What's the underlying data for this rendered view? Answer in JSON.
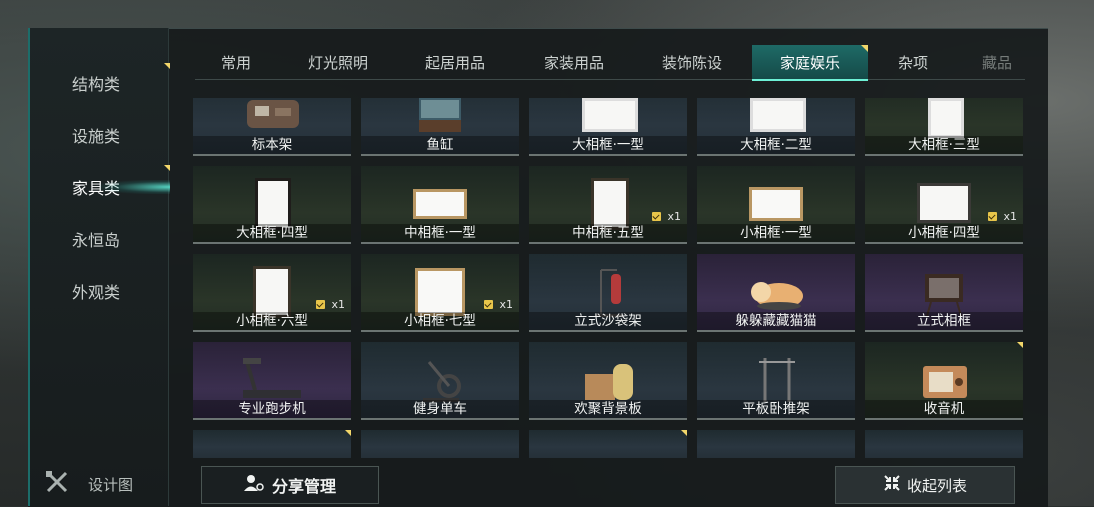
{
  "left_nav": {
    "items": [
      {
        "label": "结构类"
      },
      {
        "label": "设施类"
      },
      {
        "label": "家具类"
      },
      {
        "label": "永恒岛"
      },
      {
        "label": "外观类"
      }
    ],
    "design_label": "设计图"
  },
  "tabs": [
    {
      "label": "常用"
    },
    {
      "label": "灯光照明"
    },
    {
      "label": "起居用品"
    },
    {
      "label": "家装用品"
    },
    {
      "label": "装饰陈设"
    },
    {
      "label": "家庭娱乐"
    },
    {
      "label": "杂项"
    },
    {
      "label": "藏品"
    }
  ],
  "grid": {
    "items": [
      {
        "label": "标本架",
        "icon": "specimen-shelf-icon"
      },
      {
        "label": "鱼缸",
        "icon": "fish-tank-icon"
      },
      {
        "label": "大相框·一型",
        "icon": "photo-frame-icon"
      },
      {
        "label": "大相框·二型",
        "icon": "photo-frame-icon"
      },
      {
        "label": "大相框·三型",
        "icon": "photo-frame-icon"
      },
      {
        "label": "大相框·四型",
        "icon": "photo-frame-icon"
      },
      {
        "label": "中相框·一型",
        "icon": "photo-frame-icon"
      },
      {
        "label": "中相框·五型",
        "icon": "photo-frame-icon",
        "count": "x1"
      },
      {
        "label": "小相框·一型",
        "icon": "photo-frame-icon"
      },
      {
        "label": "小相框·四型",
        "icon": "photo-frame-icon",
        "count": "x1"
      },
      {
        "label": "小相框·六型",
        "icon": "photo-frame-icon",
        "count": "x1"
      },
      {
        "label": "小相框·七型",
        "icon": "photo-frame-icon",
        "count": "x1"
      },
      {
        "label": "立式沙袋架",
        "icon": "punching-bag-icon"
      },
      {
        "label": "躲躲藏藏猫猫",
        "icon": "cat-icon"
      },
      {
        "label": "立式相框",
        "icon": "standing-frame-icon"
      },
      {
        "label": "专业跑步机",
        "icon": "treadmill-icon"
      },
      {
        "label": "健身单车",
        "icon": "exercise-bike-icon"
      },
      {
        "label": "欢聚背景板",
        "icon": "backdrop-icon"
      },
      {
        "label": "平板卧推架",
        "icon": "bench-press-icon"
      },
      {
        "label": "收音机",
        "icon": "radio-icon"
      }
    ]
  },
  "buttons": {
    "share_label": "分享管理",
    "collapse_label": "收起列表"
  },
  "colors": {
    "accent": "#6ef1d6",
    "marker": "#f2d66a"
  }
}
